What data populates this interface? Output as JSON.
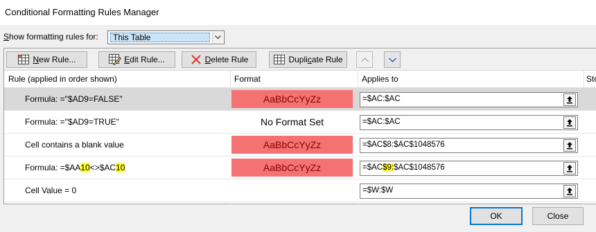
{
  "window": {
    "title": "Conditional Formatting Rules Manager"
  },
  "show_rules": {
    "label_prefix": "",
    "label_underlined": "S",
    "label_rest": "how formatting rules for:",
    "selected_value": "This Table"
  },
  "toolbar": {
    "new_rule": {
      "ul": "N",
      "rest": "ew Rule..."
    },
    "edit_rule": {
      "ul": "E",
      "rest": "dit Rule..."
    },
    "delete_rule": {
      "ul": "D",
      "rest": "elete Rule"
    },
    "duplicate_rule": {
      "pre": "Dupli",
      "ul": "c",
      "rest": "ate Rule"
    }
  },
  "columns": {
    "rule": "Rule (applied in order shown)",
    "format": "Format",
    "applies_to": "Applies to",
    "stop": "Stop If True"
  },
  "rules": [
    {
      "rule_parts": [
        {
          "text": "Formula: =\"$AD9=FALSE\""
        }
      ],
      "format_text": "AaBbCcYyZz",
      "applies_parts": [
        {
          "text": "=$AC:$AC"
        }
      ]
    },
    {
      "rule_parts": [
        {
          "text": "Formula: =\"$AD9=TRUE\""
        }
      ],
      "format_text": "No Format Set",
      "applies_parts": [
        {
          "text": "=$AC:$AC"
        }
      ]
    },
    {
      "rule_parts": [
        {
          "text": "Cell contains a blank value"
        }
      ],
      "format_text": "AaBbCcYyZz",
      "applies_parts": [
        {
          "text": "=$AC$8:$AC$1048576"
        }
      ]
    },
    {
      "rule_parts": [
        {
          "text": "Formula: =$AA"
        },
        {
          "text": "10"
        },
        {
          "text": "<>$AC"
        },
        {
          "text": "10"
        }
      ],
      "format_text": "AaBbCcYyZz",
      "applies_parts": [
        {
          "text": "=$AC"
        },
        {
          "text": "$9:"
        },
        {
          "text": "$AC$1048576"
        }
      ]
    },
    {
      "rule_parts": [
        {
          "text": "Cell Value = 0"
        }
      ],
      "format_text": "",
      "applies_parts": [
        {
          "text": "=$W:$W"
        }
      ]
    }
  ],
  "buttons": {
    "ok": "OK",
    "close": "Close"
  },
  "colors": {
    "format_fill": "#f47372",
    "format_text": "#8a0000",
    "highlight": "#ffff33",
    "selected_row": "#d9d9d9"
  }
}
